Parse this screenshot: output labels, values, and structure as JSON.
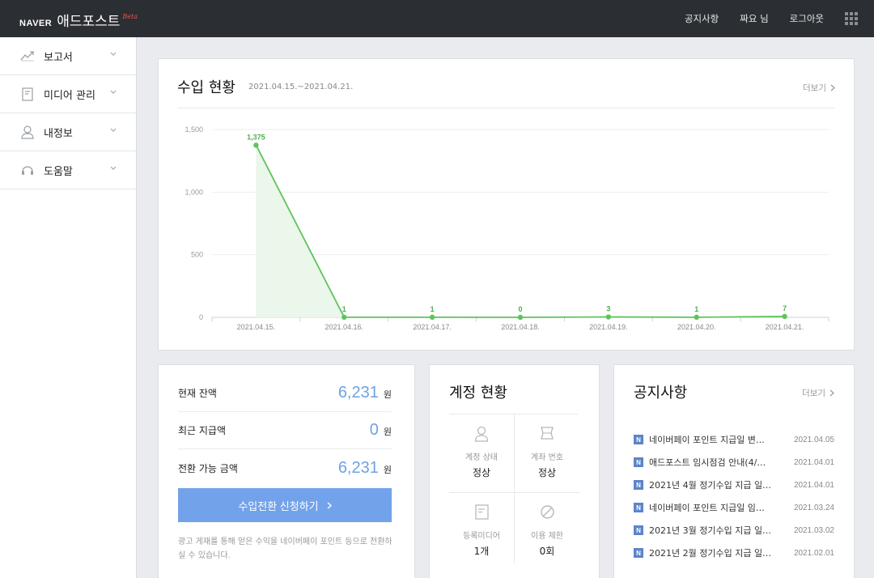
{
  "header": {
    "logo_naver": "NAVER",
    "logo_name": "애드포스트",
    "logo_beta": "Beta",
    "nav": [
      "공지사항",
      "짜요 님",
      "로그아웃"
    ],
    "apps_icon": "grid-icon"
  },
  "sidebar": {
    "items": [
      {
        "label": "보고서",
        "icon": "chart-line-icon"
      },
      {
        "label": "미디어 관리",
        "icon": "document-icon"
      },
      {
        "label": "내정보",
        "icon": "user-icon"
      },
      {
        "label": "도움말",
        "icon": "headset-icon"
      }
    ]
  },
  "income": {
    "title": "수입 현황",
    "date_range": "2021.04.15.~2021.04.21.",
    "more": "더보기"
  },
  "chart_data": {
    "type": "line",
    "categories": [
      "2021.04.15.",
      "2021.04.16.",
      "2021.04.17.",
      "2021.04.18.",
      "2021.04.19.",
      "2021.04.20.",
      "2021.04.21."
    ],
    "values": [
      1375,
      1,
      1,
      0,
      3,
      1,
      7
    ],
    "data_labels": [
      "1,375",
      "1",
      "1",
      "0",
      "3",
      "1",
      "7"
    ],
    "y_ticks": [
      0,
      500,
      1000,
      1500
    ],
    "y_tick_labels": [
      "0",
      "500",
      "1,000",
      "1,500"
    ],
    "ylim": [
      0,
      1500
    ],
    "grid": true,
    "line_color": "#5fc35a",
    "fill_color": "#eaf7ea"
  },
  "balance": {
    "rows": [
      {
        "label": "현재 잔액",
        "value": "6,231",
        "unit": "원"
      },
      {
        "label": "최근 지급액",
        "value": "0",
        "unit": "원"
      },
      {
        "label": "전환 가능 금액",
        "value": "6,231",
        "unit": "원"
      }
    ],
    "button": "수입전환 신청하기",
    "note": "광고 게재를 통해 얻은 수익을 네이버페이 포인트 등으로 전환하실 수 있습니다."
  },
  "account": {
    "title": "계정 현황",
    "cells": [
      {
        "label": "계정 상태",
        "value": "정상",
        "icon": "user-icon"
      },
      {
        "label": "계좌 번호",
        "value": "정상",
        "icon": "bankbook-icon"
      },
      {
        "label": "등록미디어",
        "value": "1개",
        "icon": "document-icon"
      },
      {
        "label": "이용 제한",
        "value": "0회",
        "icon": "ban-icon"
      }
    ]
  },
  "notice": {
    "title": "공지사항",
    "more": "더보기",
    "badge": "N",
    "items": [
      {
        "text": "네이버페이 포인트 지급일 변…",
        "date": "2021.04.05"
      },
      {
        "text": "애드포스트 임시점검 안내(4/…",
        "date": "2021.04.01"
      },
      {
        "text": "2021년 4월 정기수입 지급 일…",
        "date": "2021.04.01"
      },
      {
        "text": "네이버페이 포인트 지급일 임…",
        "date": "2021.03.24"
      },
      {
        "text": "2021년 3월 정기수입 지급 일…",
        "date": "2021.03.02"
      },
      {
        "text": "2021년 2월 정기수입 지급 일…",
        "date": "2021.02.01"
      }
    ]
  }
}
